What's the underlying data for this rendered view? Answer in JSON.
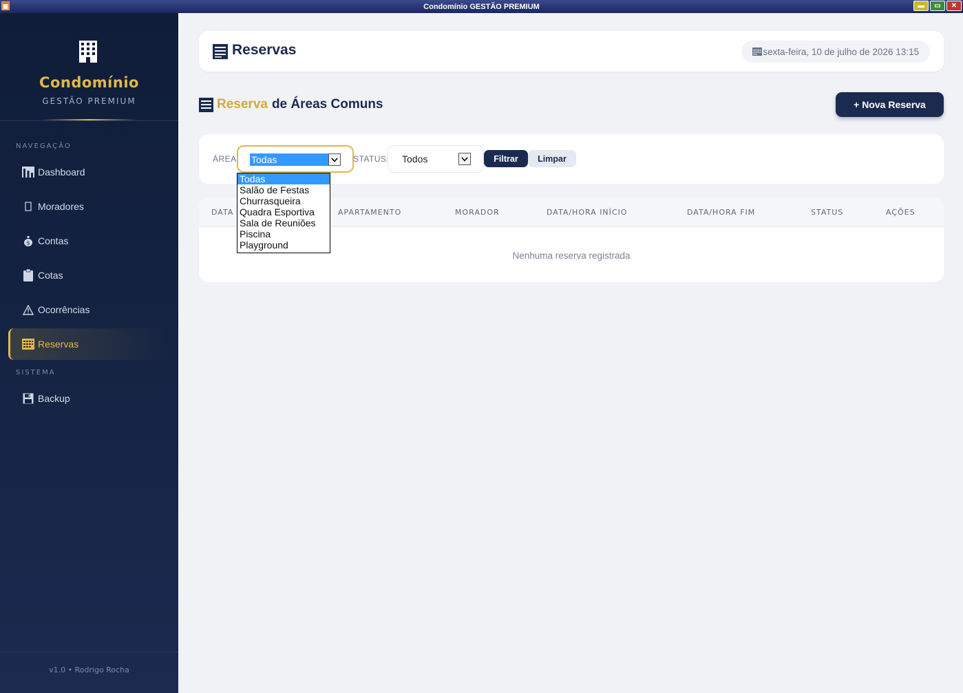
{
  "window": {
    "title": "Condomínio GESTÃO PREMIUM"
  },
  "brand": {
    "name": "Condomínio",
    "subtitle": "GESTÃO PREMIUM"
  },
  "sidebar": {
    "section_nav": "NAVEGAÇÃO",
    "section_system": "SISTEMA",
    "items": [
      {
        "label": "Dashboard",
        "icon": "chart-icon"
      },
      {
        "label": "Moradores",
        "icon": "rectangle-icon"
      },
      {
        "label": "Contas",
        "icon": "money-bag-icon"
      },
      {
        "label": "Cotas",
        "icon": "clipboard-icon"
      },
      {
        "label": "Ocorrências",
        "icon": "warning-icon"
      },
      {
        "label": "Reservas",
        "icon": "calendar-icon",
        "active": true
      }
    ],
    "system_items": [
      {
        "label": "Backup",
        "icon": "floppy-icon"
      }
    ],
    "footer": "v1.0 • Rodrigo Rocha"
  },
  "header": {
    "title": "Reservas",
    "date": "sexta-feira, 10 de julho de 2026 13:15"
  },
  "section": {
    "title_accent": "Reserva",
    "title_rest": "de Áreas Comuns",
    "new_button": "+ Nova Reserva"
  },
  "filters": {
    "area_label": "ÁREA:",
    "area_value": "Todas",
    "status_label": "STATUS:",
    "status_value": "Todos",
    "filter_button": "Filtrar",
    "clear_button": "Limpar",
    "area_options": [
      "Todas",
      "Salão de Festas",
      "Churrasqueira",
      "Quadra Esportiva",
      "Sala de Reuniões",
      "Piscina",
      "Playground"
    ]
  },
  "table": {
    "columns": [
      "DATA",
      "APARTAMENTO",
      "MORADOR",
      "DATA/HORA INÍCIO",
      "DATA/HORA FIM",
      "STATUS",
      "AÇÕES"
    ],
    "empty_message": "Nenhuma reserva registrada"
  },
  "colors": {
    "sidebar_bg": "#0f1d38",
    "accent_gold": "#e0b94a",
    "primary_navy": "#1b2a4f",
    "background": "#f0f2f6"
  }
}
